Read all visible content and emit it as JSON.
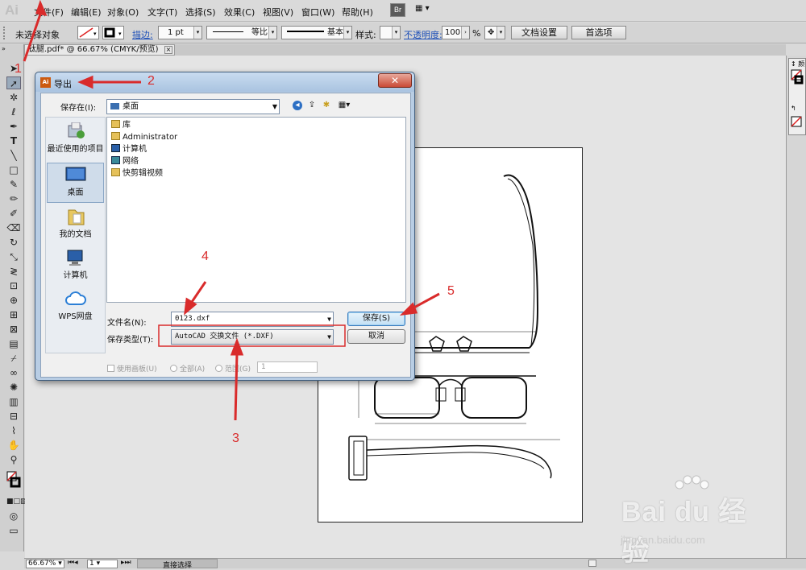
{
  "app": {
    "logo": "Ai"
  },
  "menu": [
    "文件(F)",
    "编辑(E)",
    "对象(O)",
    "文字(T)",
    "选择(S)",
    "效果(C)",
    "视图(V)",
    "窗口(W)",
    "帮助(H)"
  ],
  "menu_extra": {
    "bridge": "Br"
  },
  "control": {
    "selection": "未选择对象",
    "stroke_label": "描边:",
    "stroke_weight": "1 pt",
    "profile": "等比",
    "brush": "基本",
    "style_label": "样式:",
    "opacity_label": "不透明度:",
    "opacity_value": "100",
    "opacity_unit": "%",
    "doc_setup": "文档设置",
    "preferences": "首选项"
  },
  "document_tab": {
    "title": "钛腿.pdf* @ 66.67% (CMYK/预览)",
    "close": "×"
  },
  "statusbar": {
    "zoom": "66.67%",
    "page": "1",
    "tool": "直接选择"
  },
  "dialog": {
    "title": "导出",
    "save_in_label": "保存在(I):",
    "save_in_value": "桌面",
    "places": [
      {
        "label": "最近使用的项目",
        "icon": "recent-items-icon"
      },
      {
        "label": "桌面",
        "icon": "desktop-icon"
      },
      {
        "label": "我的文档",
        "icon": "documents-folder-icon"
      },
      {
        "label": "计算机",
        "icon": "computer-icon"
      },
      {
        "label": "WPS网盘",
        "icon": "cloud-icon"
      }
    ],
    "files": [
      {
        "name": "库",
        "icon": "library-icon"
      },
      {
        "name": "Administrator",
        "icon": "user-folder-icon"
      },
      {
        "name": "计算机",
        "icon": "computer-icon"
      },
      {
        "name": "网络",
        "icon": "network-icon"
      },
      {
        "name": "快剪辑视频",
        "icon": "folder-icon"
      }
    ],
    "filename_label": "文件名(N):",
    "filename_value": "0123.dxf",
    "filetype_label": "保存类型(T):",
    "filetype_value": "AutoCAD 交换文件 (*.DXF)",
    "save_button": "保存(S)",
    "cancel_button": "取消",
    "use_artboards": "使用画板(U)",
    "all_label": "全部(A)",
    "range_label": "范围(G)",
    "range_value": "1",
    "close": "✕"
  },
  "annotations": [
    "1",
    "2",
    "3",
    "4",
    "5"
  ],
  "watermark": {
    "main": "Bai du 经验",
    "sub": "jingyan.baidu.com"
  },
  "colors": {
    "annotation": "#d92b2b",
    "dialog_frame": "#b8cde4",
    "close_button": "#c94a36"
  }
}
